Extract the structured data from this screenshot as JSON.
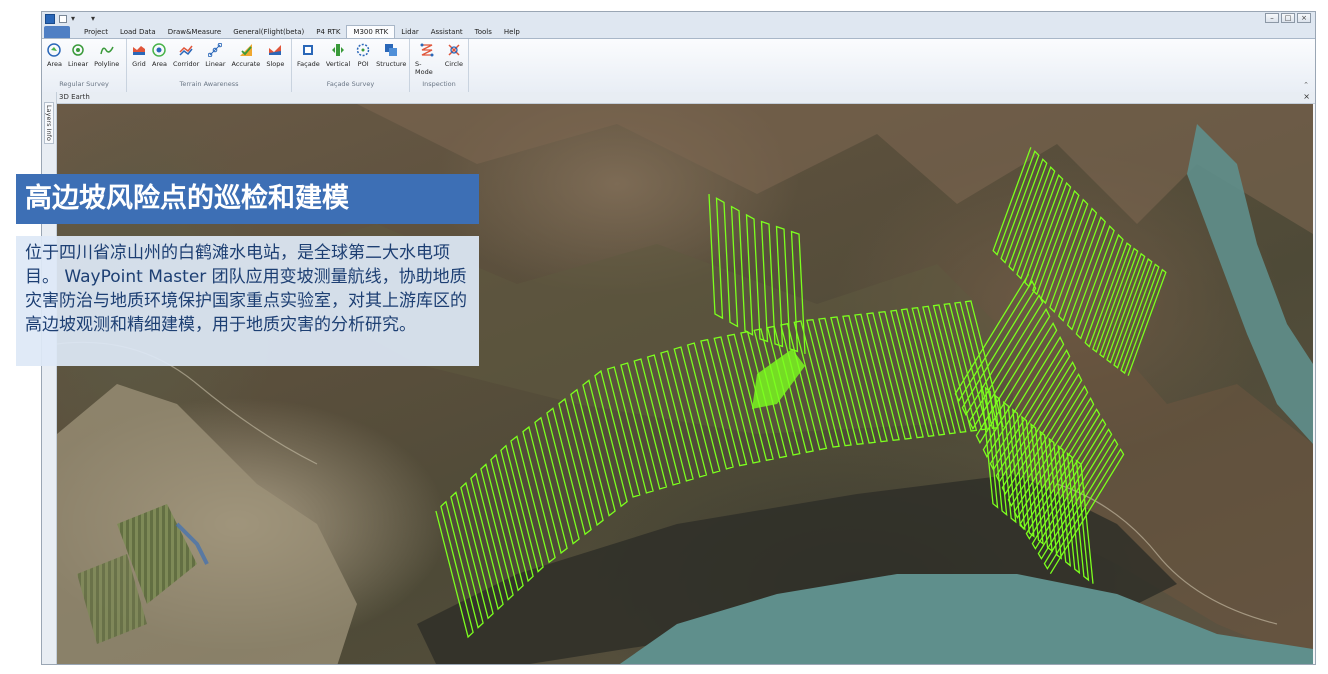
{
  "titlebar": {
    "win_controls": [
      "–",
      "□",
      "×"
    ]
  },
  "ribbon_tabs": [
    "Project",
    "Load Data",
    "Draw&Measure",
    "General(Flight(beta)",
    "P4 RTK",
    "M300 RTK",
    "Lidar",
    "Assistant",
    "Tools",
    "Help"
  ],
  "active_tab": "M300 RTK",
  "groups": {
    "regular_survey": {
      "label": "Regular Survey",
      "buttons": [
        {
          "label": "Area",
          "icon": "area-icon"
        },
        {
          "label": "Linear",
          "icon": "linear-icon"
        },
        {
          "label": "Polyline",
          "icon": "polyline-icon"
        }
      ]
    },
    "terrain_awareness": {
      "label": "Terrain Awareness",
      "buttons": [
        {
          "label": "Grid",
          "icon": "grid-icon"
        },
        {
          "label": "Area",
          "icon": "terrain-area-icon"
        },
        {
          "label": "Corridor",
          "icon": "corridor-icon"
        },
        {
          "label": "Linear",
          "icon": "terrain-linear-icon"
        },
        {
          "label": "Accurate",
          "icon": "accurate-icon"
        },
        {
          "label": "Slope",
          "icon": "slope-icon"
        }
      ]
    },
    "facade_survey": {
      "label": "Façade Survey",
      "buttons": [
        {
          "label": "Façade",
          "icon": "facade-icon"
        },
        {
          "label": "Vertical",
          "icon": "vertical-icon"
        },
        {
          "label": "POI",
          "icon": "poi-icon"
        },
        {
          "label": "Structure",
          "icon": "structure-icon"
        }
      ]
    },
    "inspection": {
      "label": "Inspection",
      "buttons": [
        {
          "label": "S-Mode",
          "icon": "s-mode-icon"
        },
        {
          "label": "Circle",
          "icon": "circle-icon"
        }
      ]
    }
  },
  "doc_tab": {
    "title": "3D Earth",
    "close": "×"
  },
  "side_panel": {
    "label": "Layers Info"
  },
  "overlay": {
    "title": "高边坡风险点的巡检和建模",
    "description": "位于四川省凉山州的白鹤滩水电站，是全球第二大水电项目。 WayPoint Master 团队应用变坡测量航线，协助地质灾害防治与地质环境保护国家重点实验室，对其上游库区的高边坡观测和精细建模，用于地质灾害的分析研究。"
  },
  "colors": {
    "accent": "#3d6fb5",
    "flight_path": "#7cff1e",
    "river": "#5f8f8c"
  }
}
